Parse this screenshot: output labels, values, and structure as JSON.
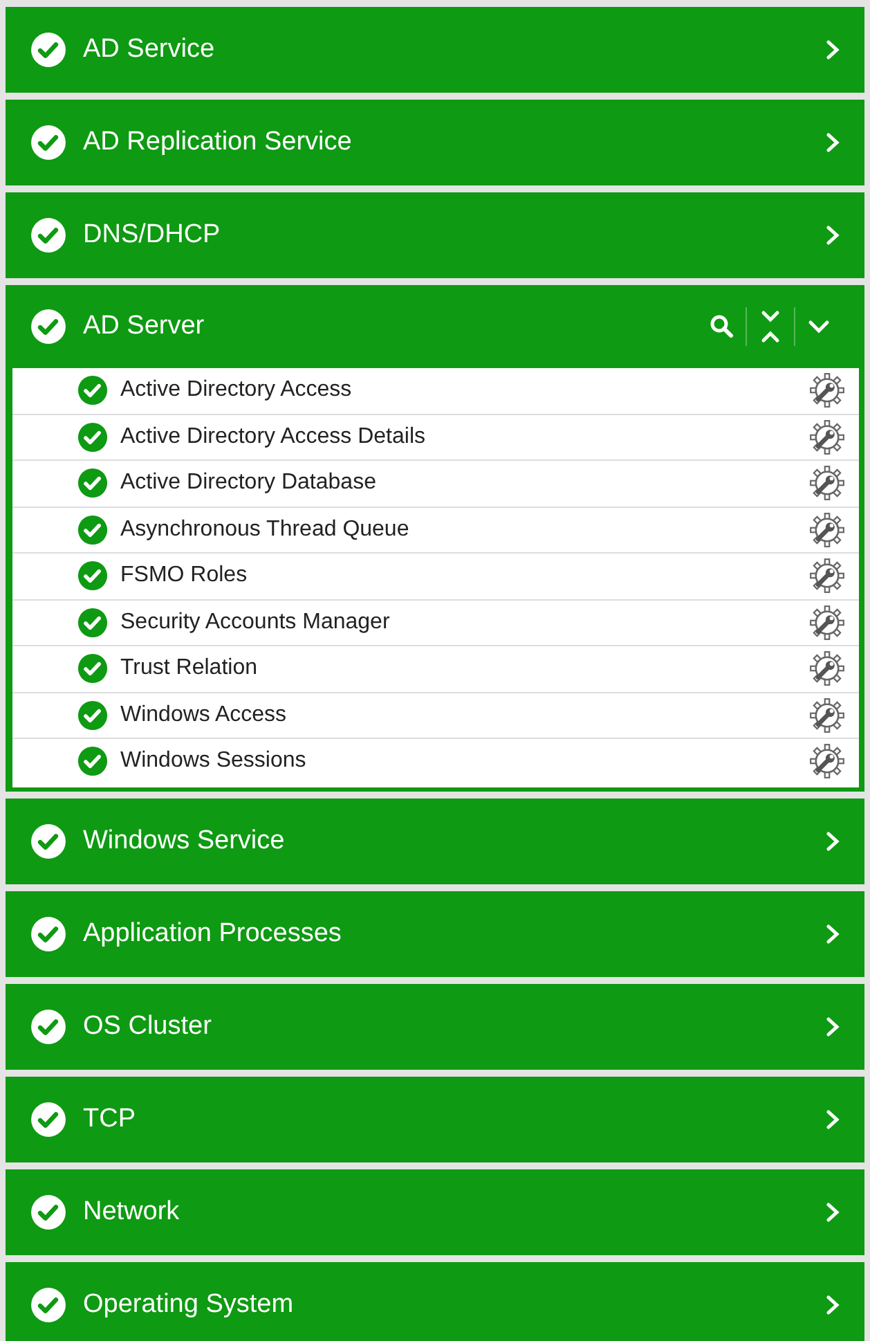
{
  "sections": [
    {
      "title": "AD Service",
      "expanded": false
    },
    {
      "title": "AD Replication Service",
      "expanded": false
    },
    {
      "title": "DNS/DHCP",
      "expanded": false
    },
    {
      "title": "AD Server",
      "expanded": true,
      "children": [
        {
          "label": "Active Directory Access"
        },
        {
          "label": "Active Directory Access Details"
        },
        {
          "label": "Active Directory Database"
        },
        {
          "label": "Asynchronous Thread Queue"
        },
        {
          "label": "FSMO Roles"
        },
        {
          "label": "Security Accounts Manager"
        },
        {
          "label": "Trust Relation"
        },
        {
          "label": "Windows Access"
        },
        {
          "label": "Windows Sessions"
        }
      ]
    },
    {
      "title": "Windows Service",
      "expanded": false
    },
    {
      "title": "Application Processes",
      "expanded": false
    },
    {
      "title": "OS Cluster",
      "expanded": false
    },
    {
      "title": "TCP",
      "expanded": false
    },
    {
      "title": "Network",
      "expanded": false
    },
    {
      "title": "Operating System",
      "expanded": false
    }
  ]
}
